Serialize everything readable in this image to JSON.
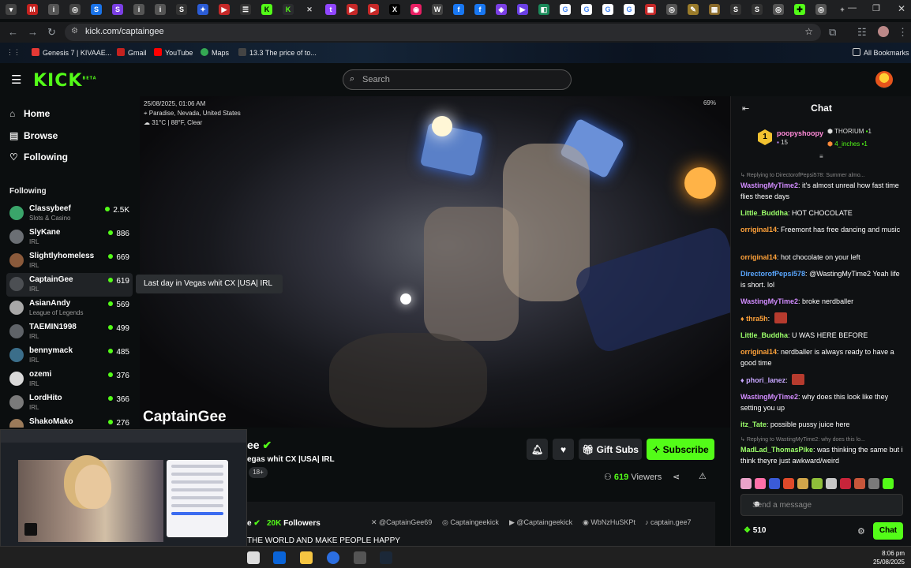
{
  "browser": {
    "url": "kick.com/captaingee",
    "bookmarks": [
      "Genesis 7 | KIVAAE...",
      "Gmail",
      "YouTube",
      "Maps",
      "13.3 The price of to..."
    ],
    "all_bookmarks": "All Bookmarks",
    "colors": {
      "tabstrip": "#1f2022",
      "accent": "#53fc18"
    }
  },
  "kick": {
    "logo": "KICK",
    "logo_sup": "BETA",
    "search_placeholder": "Search"
  },
  "sidebar": {
    "nav": [
      {
        "label": "Home",
        "icon": "home-icon"
      },
      {
        "label": "Browse",
        "icon": "browse-icon"
      },
      {
        "label": "Following",
        "icon": "heart-icon"
      }
    ],
    "following_header": "Following",
    "channels": [
      {
        "name": "Classybeef",
        "sub": "Slots & Casino",
        "viewers": "2.5K",
        "color": "#3aa56a"
      },
      {
        "name": "SlyKane",
        "sub": "IRL",
        "viewers": "886",
        "color": "#6b6f74"
      },
      {
        "name": "Slightlyhomeless",
        "sub": "IRL",
        "viewers": "669",
        "color": "#8a5a3b"
      },
      {
        "name": "CaptainGee",
        "sub": "IRL",
        "viewers": "619",
        "color": "#4c4f53"
      },
      {
        "name": "AsianAndy",
        "sub": "League of Legends",
        "viewers": "569",
        "color": "#a8a8a8"
      },
      {
        "name": "TAEMIN1998",
        "sub": "IRL",
        "viewers": "499",
        "color": "#5f6368"
      },
      {
        "name": "bennymack",
        "sub": "IRL",
        "viewers": "485",
        "color": "#3b6e8a"
      },
      {
        "name": "ozemi",
        "sub": "IRL",
        "viewers": "376",
        "color": "#d9d9d9"
      },
      {
        "name": "LordHito",
        "sub": "IRL",
        "viewers": "366",
        "color": "#7a7a7a"
      },
      {
        "name": "ShakoMako",
        "sub": "",
        "viewers": "276",
        "color": "#9c7b5a"
      }
    ],
    "tooltip": "Last day in Vegas whit CX |USA| IRL"
  },
  "video": {
    "datetime": "25/08/2025, 01:06 AM",
    "location": "Paradise, Nevada, United States",
    "weather": "31°C | 88°F, Clear",
    "battery": "69%",
    "watermark": "CaptainGee"
  },
  "stream": {
    "name_fragment": "ee",
    "title_fragment": "egas whit CX  |USA| IRL",
    "badge": "18+",
    "gift_subs": "Gift Subs",
    "subscribe": "Subscribe",
    "viewers": "619",
    "viewers_label": "Viewers",
    "name_short": "e",
    "followers": "20K",
    "followers_label": "Followers",
    "socials": [
      "@CaptainGee69",
      "Captaingeekick",
      "@Captaingeekick",
      "WbNzHuSKPt",
      "captain.gee7"
    ],
    "bio": "THE WORLD AND MAKE PEOPLE HAPPY"
  },
  "chat": {
    "header": "Chat",
    "pinned": {
      "user": "poopyshoopy",
      "count": "15",
      "rank_num": "1",
      "gifters": [
        {
          "name": "THORIUM",
          "count": "1"
        },
        {
          "name": "4_inches",
          "count": "1"
        }
      ]
    },
    "messages": [
      {
        "type": "reply",
        "text": "Replying to DirectorofPepsi578: Summer almo..."
      },
      {
        "user": "WastingMyTime2",
        "color": "#d28cff",
        "text": "it's almost unreal how fast time flies these days"
      },
      {
        "user": "Little_Buddha",
        "color": "#9cff6a",
        "text": "HOT CHOCOLATE"
      },
      {
        "user": "orriginal14",
        "color": "#ffa23a",
        "text": "Freemont has free dancing and music"
      },
      {
        "user": "orriginal14",
        "color": "#ffa23a",
        "text": "hot chocolate on your left"
      },
      {
        "user": "DirectorofPepsi578",
        "color": "#5aa7ff",
        "text": "@WastingMyTime2 Yeah life is short. lol"
      },
      {
        "user": "WastingMyTime2",
        "color": "#d28cff",
        "text": "broke nerdballer"
      },
      {
        "user": "thra5h",
        "color": "#ffa23a",
        "text": "",
        "emote": true
      },
      {
        "user": "Little_Buddha",
        "color": "#9cff6a",
        "text": "U WAS HERE BEFORE"
      },
      {
        "user": "orriginal14",
        "color": "#ffa23a",
        "text": "nerdballer is always ready to have a good time"
      },
      {
        "user": "phori_lanez",
        "color": "#c7a6ff",
        "text": "",
        "emote": true
      },
      {
        "user": "WastingMyTime2",
        "color": "#d28cff",
        "text": "why does this look like they setting you up"
      },
      {
        "user": "itz_Tate",
        "color": "#9cff6a",
        "text": "possible pussy juice here"
      },
      {
        "type": "reply",
        "text": "Replying to WastingMyTime2: why does this lo..."
      },
      {
        "user": "MadLad_ThomasPike",
        "color": "#9cff6a",
        "text": "was thinking the same but i think theyre just awkward/weird"
      }
    ],
    "input_placeholder": "Send a message",
    "points": "510",
    "send": "Chat"
  },
  "taskbar": {
    "time": "8:06 pm",
    "date": "25/08/2025"
  }
}
